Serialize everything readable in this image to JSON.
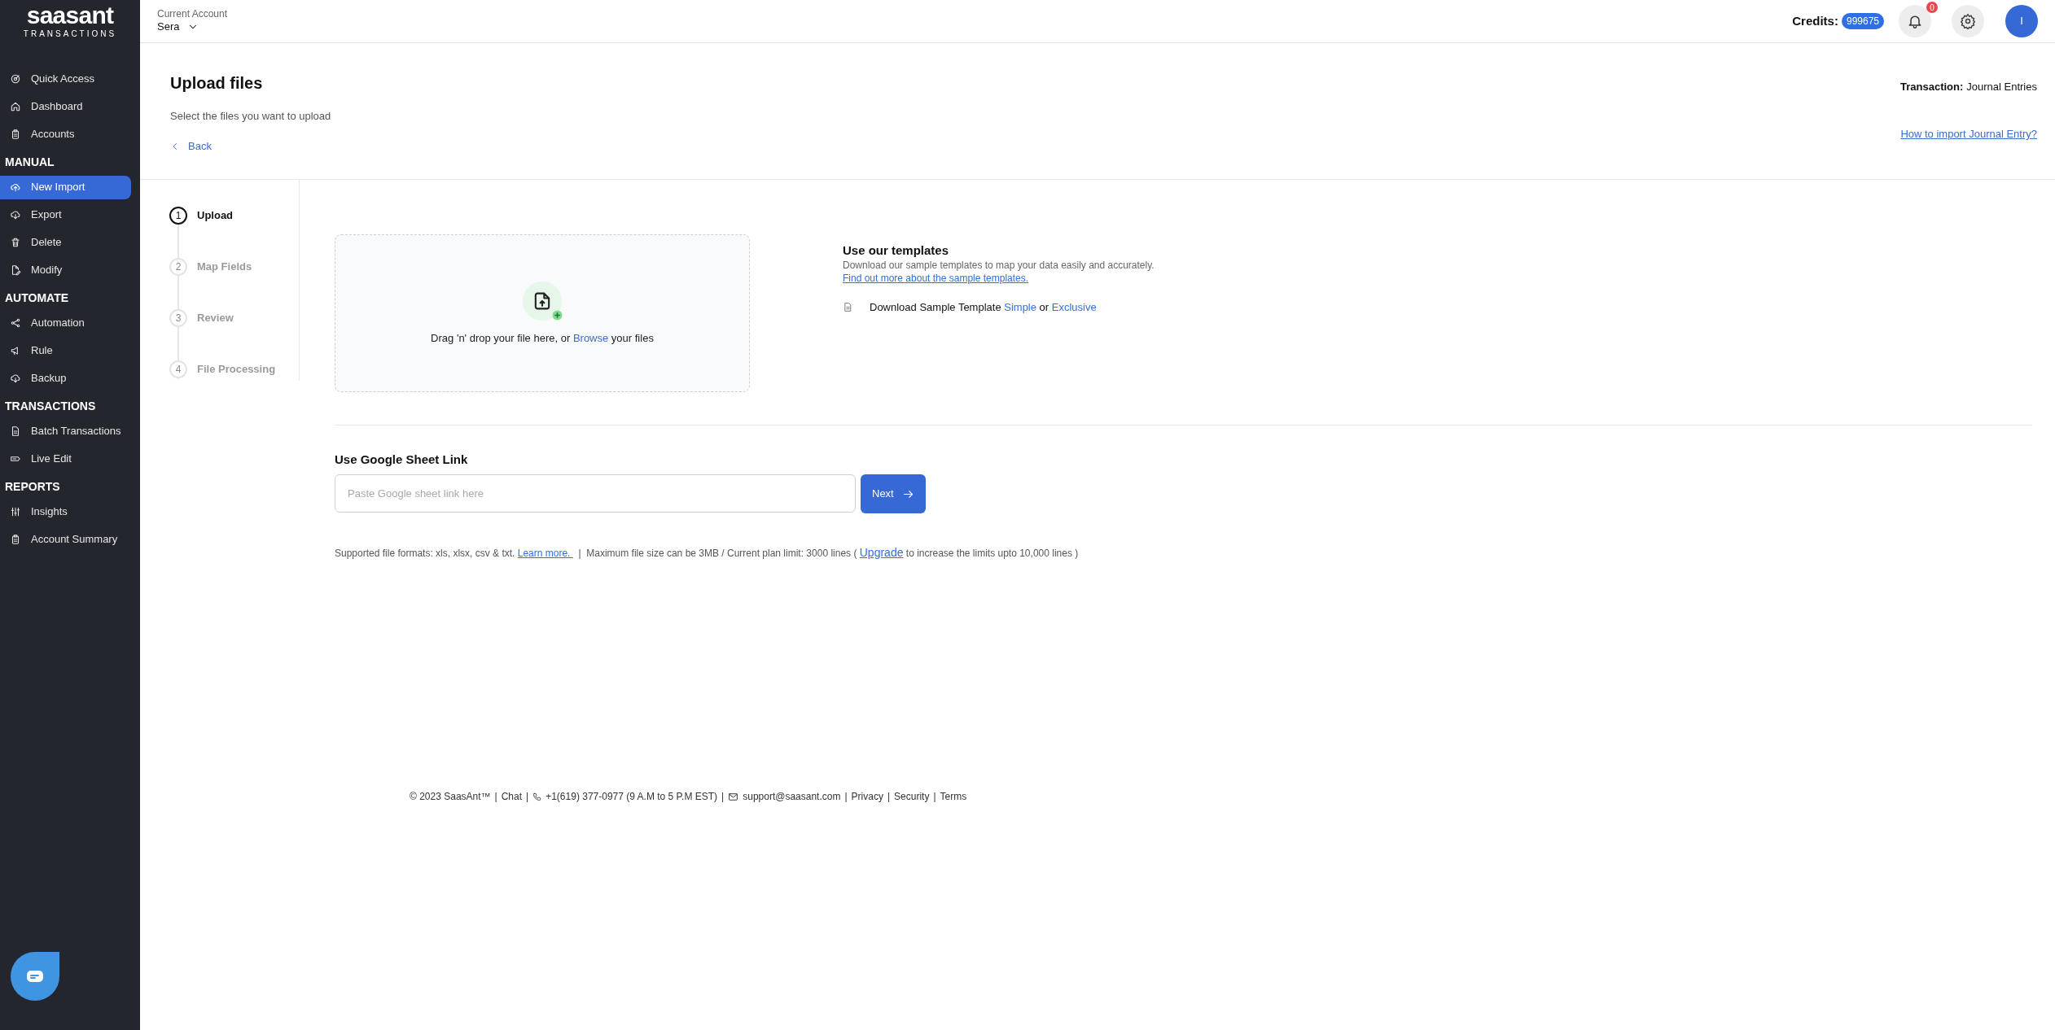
{
  "sidebar": {
    "logo": {
      "name": "saasant",
      "tagline": "TRANSACTIONS"
    },
    "sections": [
      {
        "items": [
          {
            "label": "Quick Access",
            "selected": false
          },
          {
            "label": "Dashboard",
            "selected": false
          },
          {
            "label": "Accounts",
            "selected": false
          }
        ]
      },
      {
        "title": "MANUAL",
        "items": [
          {
            "label": "New Import",
            "selected": true
          },
          {
            "label": "Export",
            "selected": false
          },
          {
            "label": "Delete",
            "selected": false
          },
          {
            "label": "Modify",
            "selected": false
          }
        ]
      },
      {
        "title": "AUTOMATE",
        "items": [
          {
            "label": "Automation",
            "selected": false
          },
          {
            "label": "Rule",
            "selected": false
          },
          {
            "label": "Backup",
            "selected": false
          }
        ]
      },
      {
        "title": "TRANSACTIONS",
        "items": [
          {
            "label": "Batch Transactions",
            "selected": false
          },
          {
            "label": "Live Edit",
            "selected": false
          }
        ]
      },
      {
        "title": "REPORTS",
        "items": [
          {
            "label": "Insights",
            "selected": false
          },
          {
            "label": "Account Summary",
            "selected": false
          }
        ]
      }
    ]
  },
  "header": {
    "account_label": "Current Account",
    "account": "Sera",
    "credits_label": "Credits:",
    "credits": "999675",
    "notification_count": "0",
    "avatar": "I"
  },
  "page": {
    "title": "Upload files",
    "subtitle": "Select the files you want to upload",
    "back": "Back",
    "transaction_label": "Transaction:",
    "transaction": "Journal Entries",
    "help_link": "How to import Journal Entry?"
  },
  "steps": [
    {
      "number": "1",
      "label": "Upload",
      "selected": true
    },
    {
      "number": "2",
      "label": "Map Fields",
      "selected": false
    },
    {
      "number": "3",
      "label": "Review",
      "selected": false
    },
    {
      "number": "4",
      "label": "File Processing",
      "selected": false
    }
  ],
  "dropzone": {
    "before": "Drag 'n' drop your file here, or",
    "link": "Browse",
    "after": "your files"
  },
  "templates": {
    "title": "Use our templates",
    "description": "Download our sample templates to map your data easily and accurately.",
    "link": "Find out more about the sample templates.",
    "download_label": "Download Sample Template",
    "simple": "Simple",
    "or": "or",
    "exclusive": "Exclusive"
  },
  "google_sheet": {
    "title": "Use Google Sheet Link",
    "placeholder": "Paste Google sheet link here",
    "button": "Next"
  },
  "supported": [
    {
      "kind": "text",
      "text": "Supported file formats: xls, xlsx, csv & txt."
    },
    {
      "kind": "link",
      "text": "Learn more. "
    },
    {
      "kind": "sep",
      "text": "|"
    },
    {
      "kind": "text",
      "text": "Maximum file size can be 3MB / Current plan limit: 3000 lines ("
    },
    {
      "kind": "link",
      "text": "Upgrade"
    },
    {
      "kind": "text",
      "text": "to increase the limits upto 10,000 lines )"
    }
  ],
  "footer": [
    {
      "kind": "text",
      "text": "© 2023 SaasAnt™"
    },
    {
      "kind": "sep",
      "text": "|"
    },
    {
      "kind": "text",
      "text": "Chat"
    },
    {
      "kind": "sep",
      "text": "|"
    },
    {
      "kind": "phone",
      "text": "+1(619) 377-0977 (9 A.M to 5 P.M EST)"
    },
    {
      "kind": "sep",
      "text": "|"
    },
    {
      "kind": "email",
      "text": "support@saasant.com"
    },
    {
      "kind": "sep",
      "text": "|"
    },
    {
      "kind": "text",
      "text": "Privacy"
    },
    {
      "kind": "sep",
      "text": "|"
    },
    {
      "kind": "text",
      "text": "Security"
    },
    {
      "kind": "sep",
      "text": "|"
    },
    {
      "kind": "text",
      "text": "Terms"
    }
  ]
}
